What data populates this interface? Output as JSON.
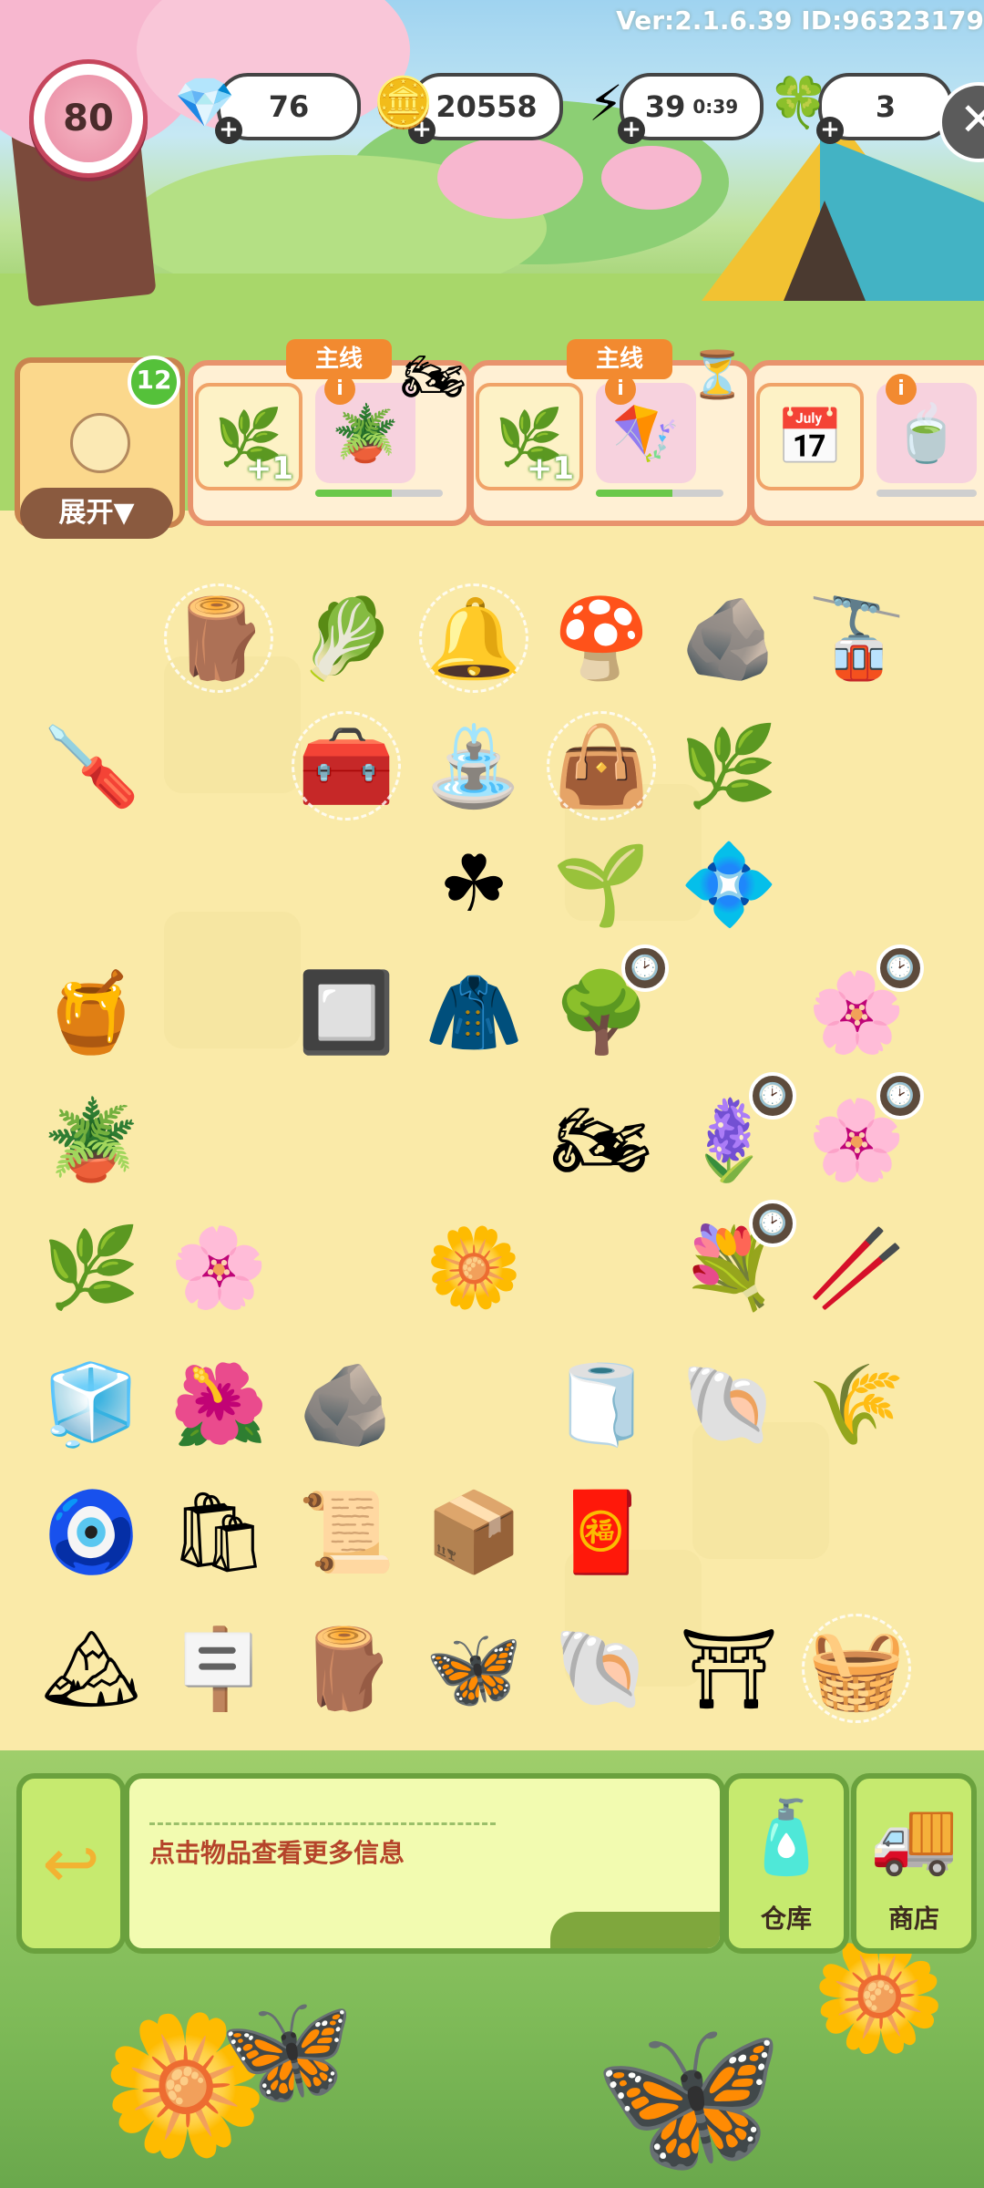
{
  "version_text": "Ver:2.1.6.39 ID:96323179",
  "player": {
    "level": "80"
  },
  "resources": {
    "gems": "76",
    "coins": "20558",
    "energy": "39",
    "energy_timer": "0:39",
    "clovers": "3"
  },
  "icons": {
    "gem": "💎",
    "coin": "🪙",
    "energy": "⚡",
    "clover": "🍀",
    "close": "✕",
    "leaf": "🌿",
    "vine_swing": "🪴",
    "motorcycle": "🏍",
    "kite": "🪁",
    "hourglass": "⏳",
    "calendar": "📅",
    "tea_set": "🍵",
    "clock": "🕑",
    "back": "↩",
    "warehouse": "🧴",
    "shop": "🚚"
  },
  "queue": {
    "badge": "12",
    "expand_label": "展开▼"
  },
  "orders": [
    {
      "tag": "主线",
      "bonus_label": "+1",
      "progress": 0.6
    },
    {
      "tag": "主线",
      "bonus_label": "+1",
      "progress": 0.6
    },
    {
      "progress": 0.0
    }
  ],
  "board": {
    "items": [
      {
        "name": "bundled-logs",
        "icon": "🪵",
        "webbed": true
      },
      {
        "name": "leafy-plant",
        "icon": "🥬"
      },
      {
        "name": "green-bell",
        "icon": "🔔",
        "webbed": true
      },
      {
        "name": "mushrooms",
        "icon": "🍄"
      },
      {
        "name": "signpost-stones",
        "icon": "🪨"
      },
      {
        "name": "cable-car",
        "icon": "🚡"
      },
      {
        "name": "chisel",
        "icon": "🪛"
      },
      {
        "name": "gold-box",
        "icon": "🧰",
        "webbed": true
      },
      {
        "name": "fountain",
        "icon": "⛲"
      },
      {
        "name": "gold-bag",
        "icon": "👜",
        "webbed": true
      },
      {
        "name": "blue-flower-vine",
        "icon": "🌿"
      },
      {
        "name": "clover-sprig",
        "icon": "☘"
      },
      {
        "name": "seedling",
        "icon": "🌱"
      },
      {
        "name": "blue-flowers",
        "icon": "💠"
      },
      {
        "name": "honey-jar",
        "icon": "🍯"
      },
      {
        "name": "stone-tile",
        "icon": "🔲"
      },
      {
        "name": "leather-jacket",
        "icon": "🧥"
      },
      {
        "name": "sapling-tree",
        "icon": "🌳",
        "timer": true
      },
      {
        "name": "cherry-tree",
        "icon": "🌸",
        "timer": true
      },
      {
        "name": "vine-swing",
        "icon": "🪴"
      },
      {
        "name": "electric-motorcycle",
        "icon": "🏍"
      },
      {
        "name": "flower-crate",
        "icon": "🪻",
        "timer": true
      },
      {
        "name": "cherry-tree-2",
        "icon": "🌸",
        "timer": true
      },
      {
        "name": "herb-bundle",
        "icon": "🌿"
      },
      {
        "name": "blossom-twig",
        "icon": "🌸"
      },
      {
        "name": "blue-flower",
        "icon": "🌼"
      },
      {
        "name": "flower-basket",
        "icon": "💐",
        "timer": true
      },
      {
        "name": "hiking-poles",
        "icon": "🥢"
      },
      {
        "name": "jade-cube",
        "icon": "🧊"
      },
      {
        "name": "blossom-cloth",
        "icon": "🌺"
      },
      {
        "name": "rocks",
        "icon": "🪨"
      },
      {
        "name": "yoga-mat",
        "icon": "🧻"
      },
      {
        "name": "silver-shell",
        "icon": "🐚"
      },
      {
        "name": "grass-tuft",
        "icon": "🌾"
      },
      {
        "name": "charm-pendant",
        "icon": "🧿"
      },
      {
        "name": "snack-bag",
        "icon": "🛍"
      },
      {
        "name": "scroll",
        "icon": "📜"
      },
      {
        "name": "storage-box",
        "icon": "📦"
      },
      {
        "name": "red-ticket",
        "icon": "🧧"
      },
      {
        "name": "mountain-diorama",
        "icon": "🏔"
      },
      {
        "name": "wood-board",
        "icon": "🪧"
      },
      {
        "name": "wood-planks",
        "icon": "🪵"
      },
      {
        "name": "butterfly",
        "icon": "🦋"
      },
      {
        "name": "butterfly-cocoon",
        "icon": "🐚"
      },
      {
        "name": "pavilion",
        "icon": "⛩"
      },
      {
        "name": "webbed-sack",
        "icon": "🧺",
        "webbed": true
      }
    ]
  },
  "hint": {
    "text": "点击物品查看更多信息"
  },
  "buttons": {
    "warehouse_label": "仓库",
    "shop_label": "商店"
  }
}
